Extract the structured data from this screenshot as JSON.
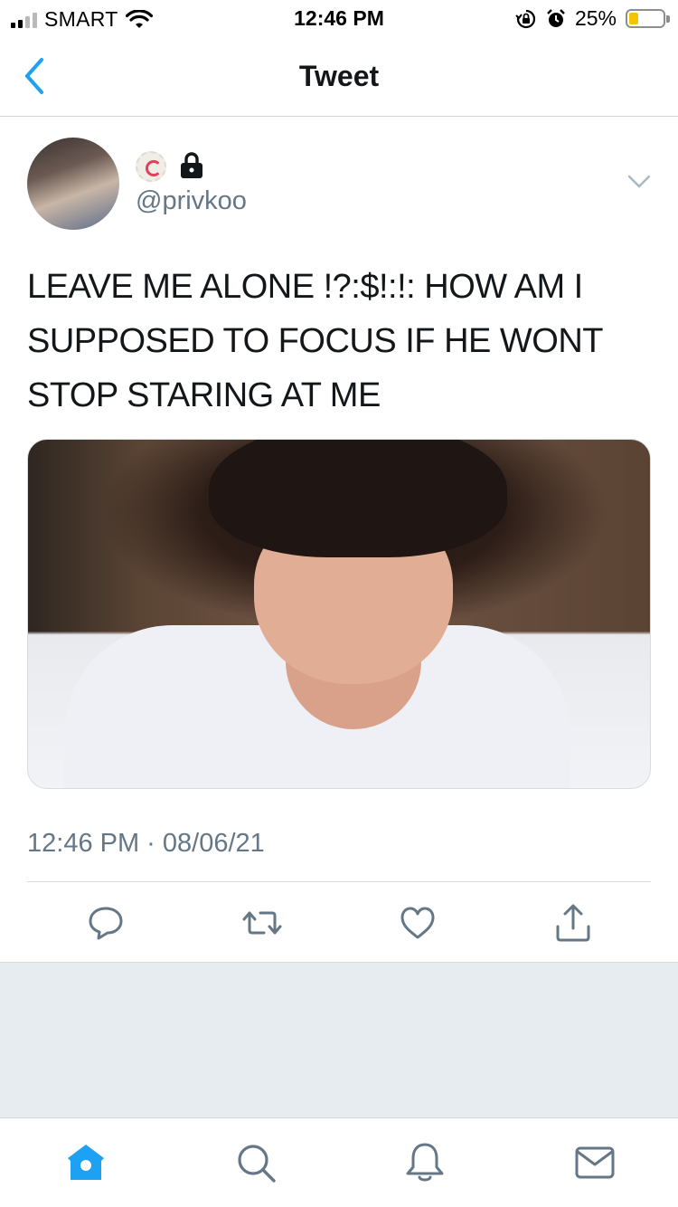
{
  "status_bar": {
    "carrier": "SMART",
    "time": "12:46 PM",
    "battery_percent": "25%",
    "battery_level": 0.25,
    "icons": [
      "signal-icon",
      "wifi-icon",
      "orientation-lock-icon",
      "alarm-icon",
      "battery-icon"
    ]
  },
  "nav": {
    "title": "Tweet",
    "back_icon": "chevron-left-icon"
  },
  "tweet": {
    "handle": "@privkoo",
    "text": "LEAVE ME ALONE !?:$!:!: HOW AM I SUPPOSED TO FOCUS IF HE WONT STOP STARING AT ME",
    "timestamp": "12:46 PM · 08/06/21",
    "badges": [
      "emoji-badge-icon",
      "lock-icon"
    ],
    "media": "photo"
  },
  "actions": [
    "reply-icon",
    "retweet-icon",
    "like-icon",
    "share-icon"
  ],
  "tab_bar": {
    "tabs": [
      "home-icon",
      "search-icon",
      "notifications-icon",
      "messages-icon"
    ],
    "active": "home-icon"
  },
  "colors": {
    "accent": "#1da1f2",
    "text": "#14171a",
    "muted": "#657786",
    "divider": "#d7dce0",
    "background_gray": "#e6ecf0",
    "battery_fill": "#f5c400"
  }
}
